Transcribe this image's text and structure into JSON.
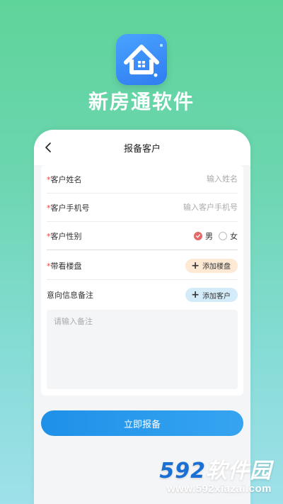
{
  "app": {
    "name": "新房通软件"
  },
  "header": {
    "title": "报备客户"
  },
  "form": {
    "required_mark": "*",
    "name": {
      "label": "客户姓名",
      "placeholder": "输入姓名"
    },
    "phone": {
      "label": "客户手机号",
      "placeholder": "输入客户手机号"
    },
    "gender": {
      "label": "客户性别",
      "options": [
        "男",
        "女"
      ],
      "selected": "男"
    },
    "property": {
      "label": "带看楼盘",
      "button": "添加楼盘"
    },
    "notes": {
      "label": "意向信息备注",
      "button": "添加客户",
      "placeholder": "请输入备注"
    }
  },
  "submit_label": "立即报备",
  "watermark": {
    "logo_num": "592",
    "logo_text": "软件园",
    "url": "www.592xiazai.com"
  },
  "colors": {
    "primary": "#1e90e8",
    "accent_red": "#e36a6a",
    "required": "#e8453c"
  }
}
